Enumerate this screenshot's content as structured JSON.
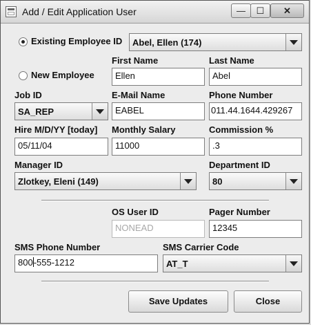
{
  "window": {
    "title": "Add / Edit Application User",
    "minimize_glyph": "—",
    "maximize_glyph": "☐",
    "close_glyph": "✕"
  },
  "employee_mode": {
    "existing_label": "Existing Employee ID",
    "existing_selected": true,
    "existing_value": "Abel, Ellen (174)",
    "new_label": "New Employee"
  },
  "fields": {
    "first_name": {
      "label": "First Name",
      "value": "Ellen"
    },
    "last_name": {
      "label": "Last Name",
      "value": "Abel"
    },
    "job_id": {
      "label": "Job ID",
      "value": "SA_REP"
    },
    "email_name": {
      "label": "E-Mail Name",
      "value": "EABEL"
    },
    "phone_number": {
      "label": "Phone Number",
      "value": "011.44.1644.429267"
    },
    "hire_date": {
      "label": "Hire M/D/YY [today]",
      "value": "05/11/04"
    },
    "monthly_salary": {
      "label": "Monthly Salary",
      "value": "11000"
    },
    "commission": {
      "label": "Commission %",
      "value": ".3"
    },
    "manager_id": {
      "label": "Manager ID",
      "value": "Zlotkey, Eleni (149)"
    },
    "department_id": {
      "label": "Department ID",
      "value": "80"
    },
    "os_user_id": {
      "label": "OS User ID",
      "value": "NONEAD"
    },
    "pager_number": {
      "label": "Pager Number",
      "value": "12345"
    },
    "sms_phone": {
      "label": "SMS Phone Number",
      "value_before_caret": "800",
      "value_after_caret": "-555-1212"
    },
    "sms_carrier": {
      "label": "SMS Carrier Code",
      "value": "AT_T"
    }
  },
  "buttons": {
    "save": "Save Updates",
    "close": "Close"
  }
}
